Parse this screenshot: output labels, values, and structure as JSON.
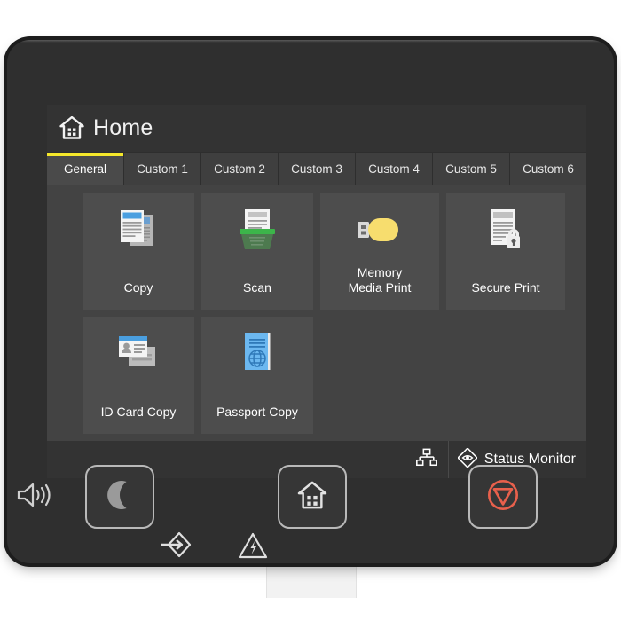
{
  "device": {
    "name": "multifunction-printer-control-panel",
    "bezel_color": "#2f2f2f",
    "screen_color": "#3b3b3b"
  },
  "header": {
    "title": "Home",
    "icon": "home-icon",
    "accent_color": "#f5e82b"
  },
  "tabs": [
    {
      "label": "General",
      "active": true
    },
    {
      "label": "Custom 1",
      "active": false
    },
    {
      "label": "Custom 2",
      "active": false
    },
    {
      "label": "Custom 3",
      "active": false
    },
    {
      "label": "Custom 4",
      "active": false
    },
    {
      "label": "Custom 5",
      "active": false
    },
    {
      "label": "Custom 6",
      "active": false
    }
  ],
  "tiles": [
    {
      "label": "Copy",
      "icon": "copy-documents-icon",
      "accent": "#4a9fe0"
    },
    {
      "label": "Scan",
      "icon": "scanner-icon",
      "accent": "#2eaa4a"
    },
    {
      "label": "Memory\nMedia Print",
      "icon": "usb-drive-icon",
      "accent": "#f7dd6e"
    },
    {
      "label": "Secure Print",
      "icon": "document-lock-icon",
      "accent": "#d8d8d8"
    },
    {
      "label": "ID Card Copy",
      "icon": "id-card-icon",
      "accent": "#4a9fe0"
    },
    {
      "label": "Passport Copy",
      "icon": "passport-book-icon",
      "accent": "#6cb8f0"
    }
  ],
  "status_bar": {
    "network_icon": "network-topology-icon",
    "status_monitor_icon": "eye-diamond-icon",
    "status_monitor_label": "Status Monitor"
  },
  "hardware": {
    "speaker_icon": "speaker-volume-icon",
    "sleep_button_icon": "crescent-moon-icon",
    "home_button_icon": "house-icon",
    "stop_button_icon": "stop-circle-triangle-icon",
    "stop_button_color": "#e8604c",
    "data_indicator_icon": "data-arrow-diamond-icon",
    "error_indicator_icon": "warning-triangle-icon"
  }
}
